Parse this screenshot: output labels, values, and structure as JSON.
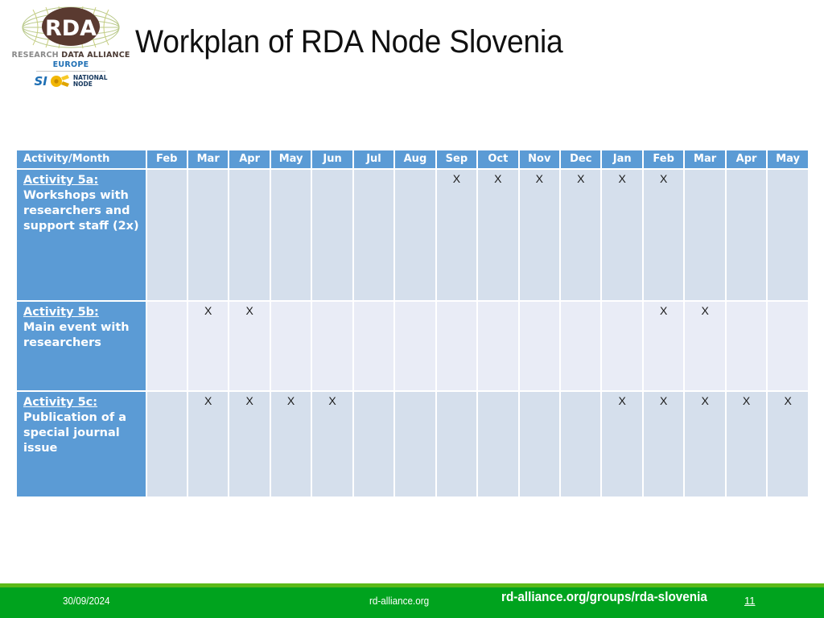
{
  "slide": {
    "title": "Workplan of RDA Node Slovenia"
  },
  "logo": {
    "acronym": "RDA",
    "wordmark_research": "RESEARCH ",
    "wordmark_data_alliance": "DATA ALLIANCE",
    "region": "EUROPE",
    "country_code": "SI",
    "node_line1": "NATIONAL",
    "node_line2": "NODE"
  },
  "table": {
    "activity_header": "Activity/Month",
    "months": [
      "Feb",
      "Mar",
      "Apr",
      "May",
      "Jun",
      "Jul",
      "Aug",
      "Sep",
      "Oct",
      "Nov",
      "Dec",
      "Jan",
      "Feb",
      "Mar",
      "Apr",
      "May"
    ],
    "mark": "X",
    "rows": [
      {
        "id": "Activity 5a:",
        "text": "Workshops with researchers and support staff (2x)",
        "marks": [
          "",
          "",
          "",
          "",
          "",
          "",
          "",
          "X",
          "X",
          "X",
          "X",
          "X",
          "X",
          "",
          "",
          ""
        ]
      },
      {
        "id": "Activity 5b:",
        "text": "Main event with researchers",
        "marks": [
          "",
          "X",
          "X",
          "",
          "",
          "",
          "",
          "",
          "",
          "",
          "",
          "",
          "X",
          "X",
          "",
          ""
        ]
      },
      {
        "id": "Activity 5c:",
        "text": "Publication of a special journal issue",
        "marks": [
          "",
          "X",
          "X",
          "X",
          "X",
          "",
          "",
          "",
          "",
          "",
          "",
          "X",
          "X",
          "X",
          "X",
          "X"
        ]
      }
    ]
  },
  "footer": {
    "date": "30/09/2024",
    "site": "rd-alliance.org",
    "group_url": "rd-alliance.org/groups/rda-slovenia",
    "page_number": "11"
  },
  "colors": {
    "header_blue": "#5b9bd5",
    "band_a": "#d5dfec",
    "band_b": "#e9ecf6",
    "footer_green": "#00a31e",
    "footer_stripe": "#5cb918"
  }
}
